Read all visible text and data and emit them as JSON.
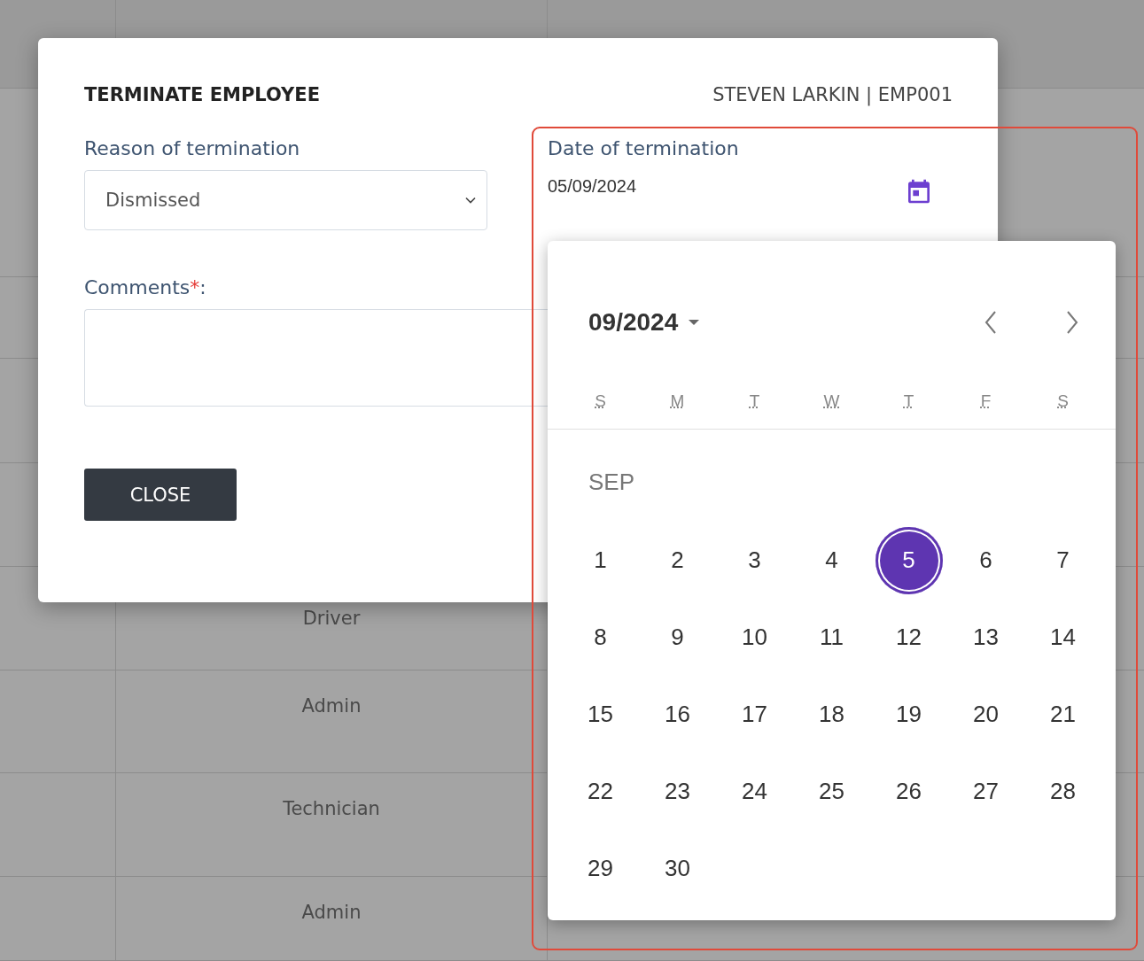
{
  "table": {
    "rows": [
      {
        "column_2": "Driver"
      },
      {
        "column_2": "Admin"
      },
      {
        "column_2": "Technician"
      },
      {
        "column_2": "Admin"
      }
    ]
  },
  "dialog": {
    "title": "TERMINATE EMPLOYEE",
    "employee": "STEVEN LARKIN | EMP001",
    "reason": {
      "label": "Reason of termination",
      "value": "Dismissed"
    },
    "date": {
      "label": "Date of termination",
      "value": "05/09/2024"
    },
    "comments": {
      "label": "Comments",
      "required_mark": "*",
      "label_end": ":"
    },
    "buttons": [
      "CLOSE"
    ]
  },
  "datepicker": {
    "month_label": "09/2024",
    "weekdays": [
      "S",
      "M",
      "T",
      "W",
      "T",
      "F",
      "S"
    ],
    "section": "SEP",
    "days": [
      {
        "label": "1",
        "selected": false
      },
      {
        "label": "2",
        "selected": false
      },
      {
        "label": "3",
        "selected": false
      },
      {
        "label": "4",
        "selected": false
      },
      {
        "label": "5",
        "selected": true
      },
      {
        "label": "6",
        "selected": false
      },
      {
        "label": "7",
        "selected": false
      },
      {
        "label": "8",
        "selected": false
      },
      {
        "label": "9",
        "selected": false
      },
      {
        "label": "10",
        "selected": false
      },
      {
        "label": "11",
        "selected": false
      },
      {
        "label": "12",
        "selected": false
      },
      {
        "label": "13",
        "selected": false
      },
      {
        "label": "14",
        "selected": false
      },
      {
        "label": "15",
        "selected": false
      },
      {
        "label": "16",
        "selected": false
      },
      {
        "label": "17",
        "selected": false
      },
      {
        "label": "18",
        "selected": false
      },
      {
        "label": "19",
        "selected": false
      },
      {
        "label": "20",
        "selected": false
      },
      {
        "label": "21",
        "selected": false
      },
      {
        "label": "22",
        "selected": false
      },
      {
        "label": "23",
        "selected": false
      },
      {
        "label": "24",
        "selected": false
      },
      {
        "label": "25",
        "selected": false
      },
      {
        "label": "26",
        "selected": false
      },
      {
        "label": "27",
        "selected": false
      },
      {
        "label": "28",
        "selected": false
      },
      {
        "label": "29",
        "selected": false
      },
      {
        "label": "30",
        "selected": false
      }
    ]
  }
}
